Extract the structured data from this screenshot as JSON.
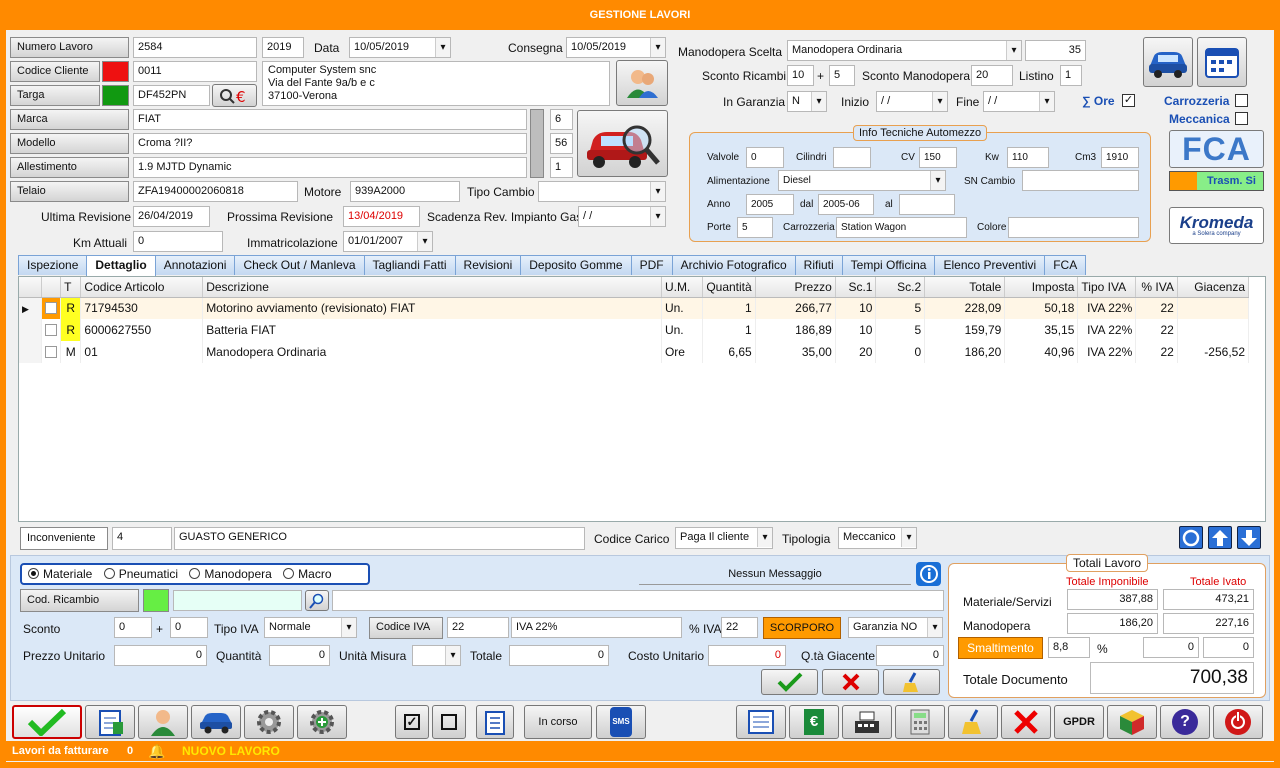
{
  "title": "GESTIONE LAVORI",
  "header": {
    "numero_lavoro_label": "Numero Lavoro",
    "numero_lavoro": "2584",
    "anno": "2019",
    "data_label": "Data",
    "data": "10/05/2019",
    "consegna_label": "Consegna",
    "consegna": "10/05/2019",
    "codice_cliente_label": "Codice Cliente",
    "codice_cliente": "0011",
    "cliente_line1": "Computer System snc",
    "cliente_line2": "Via del Fante 9a/b e c",
    "cliente_line3": "37100-Verona",
    "targa_label": "Targa",
    "targa": "DF452PN",
    "marca_label": "Marca",
    "marca": "FIAT",
    "marca_num": "6",
    "modello_label": "Modello",
    "modello": "Croma ?II?",
    "modello_num": "56",
    "allestimento_label": "Allestimento",
    "allestimento": "1.9 MJTD Dynamic",
    "allestimento_num": "1",
    "telaio_label": "Telaio",
    "telaio": "ZFA19400002060818",
    "motore_label": "Motore",
    "motore": "939A2000",
    "tipo_cambio_label": "Tipo Cambio",
    "tipo_cambio": "",
    "ultima_revisione_label": "Ultima Revisione",
    "ultima_revisione": "26/04/2019",
    "prossima_revisione_label": "Prossima Revisione",
    "prossima_revisione": "13/04/2019",
    "scadenza_gas_label": "Scadenza Rev. Impianto Gas",
    "scadenza_gas": "/ /",
    "km_label": "Km Attuali",
    "km": "0",
    "immatricolazione_label": "Immatricolazione",
    "immatricolazione": "01/01/2007"
  },
  "manodopera": {
    "scelta_label": "Manodopera Scelta",
    "scelta": "Manodopera Ordinaria",
    "scelta_val": "35",
    "sconto_ricambi_label": "Sconto Ricambi",
    "sconto_ricambi_1": "10",
    "plus": "+",
    "sconto_ricambi_2": "5",
    "sconto_manodopera_label": "Sconto Manodopera",
    "sconto_manodopera": "20",
    "listino_label": "Listino",
    "listino": "1",
    "garanzia_label": "In Garanzia",
    "garanzia": "N",
    "inizio_label": "Inizio",
    "inizio": "/ /",
    "fine_label": "Fine",
    "fine": "/ /",
    "sum_ore_label": "∑ Ore",
    "sum_ore_check": "✓",
    "carrozzeria_label": "Carrozzeria",
    "meccanica_label": "Meccanica"
  },
  "info_tecniche": {
    "title": "Info Tecniche Automezzo",
    "valvole_label": "Valvole",
    "valvole": "0",
    "cilindri_label": "Cilindri",
    "cilindri": "",
    "cv_label": "CV",
    "cv": "150",
    "kw_label": "Kw",
    "kw": "110",
    "cm3_label": "Cm3",
    "cm3": "1910",
    "alimentazione_label": "Alimentazione",
    "alimentazione": "Diesel",
    "sn_cambio_label": "SN Cambio",
    "sn_cambio": "",
    "anno_label": "Anno",
    "anno": "2005",
    "dal_label": "dal",
    "dal": "2005-06",
    "al_label": "al",
    "al": "",
    "porte_label": "Porte",
    "porte": "5",
    "carrozzeria_label": "Carrozzeria",
    "carrozzeria": "Station Wagon",
    "colore_label": "Colore",
    "colore": ""
  },
  "brand": {
    "fca": "FCA",
    "trasm": "Trasm. Si",
    "kromeda": "Kromeda",
    "kromeda_sub": "a Solera company"
  },
  "tabs": [
    "Ispezione",
    "Dettaglio",
    "Annotazioni",
    "Check Out / Manleva",
    "Tagliandi Fatti",
    "Revisioni",
    "Deposito Gomme",
    "PDF",
    "Archivio Fotografico",
    "Rifiuti",
    "Tempi Officina",
    "Elenco Preventivi",
    "FCA"
  ],
  "grid": {
    "columns": [
      "",
      "",
      "T",
      "Codice Articolo",
      "Descrizione",
      "U.M.",
      "Quantità",
      "Prezzo",
      "Sc.1",
      "Sc.2",
      "Totale",
      "Imposta",
      "Tipo IVA",
      "% IVA",
      "Giacenza"
    ],
    "rows": [
      {
        "t": "R",
        "codice": "71794530",
        "descrizione": "Motorino avviamento (revisionato) FIAT",
        "um": "Un.",
        "qta": "1",
        "prezzo": "266,77",
        "sc1": "10",
        "sc2": "5",
        "totale": "228,09",
        "imposta": "50,18",
        "tipo_iva": "IVA 22%",
        "perc_iva": "22",
        "giacenza": ""
      },
      {
        "t": "R",
        "codice": "6000627550",
        "descrizione": "Batteria FIAT",
        "um": "Un.",
        "qta": "1",
        "prezzo": "186,89",
        "sc1": "10",
        "sc2": "5",
        "totale": "159,79",
        "imposta": "35,15",
        "tipo_iva": "IVA 22%",
        "perc_iva": "22",
        "giacenza": ""
      },
      {
        "t": "M",
        "codice": "01",
        "descrizione": "Manodopera Ordinaria",
        "um": "Ore",
        "qta": "6,65",
        "prezzo": "35,00",
        "sc1": "20",
        "sc2": "0",
        "totale": "186,20",
        "imposta": "40,96",
        "tipo_iva": "IVA 22%",
        "perc_iva": "22",
        "giacenza": "-256,52"
      }
    ]
  },
  "inconveniente": {
    "label": "Inconveniente",
    "num": "4",
    "desc": "GUASTO GENERICO",
    "codice_carico_label": "Codice Carico",
    "codice_carico": "Paga Il cliente",
    "tipologia_label": "Tipologia",
    "tipologia": "Meccanico"
  },
  "lower": {
    "radio": [
      "Materiale",
      "Pneumatici",
      "Manodopera",
      "Macro"
    ],
    "messaggio": "Nessun Messaggio",
    "cod_ricambio_label": "Cod. Ricambio",
    "sconto_label": "Sconto",
    "sconto1": "0",
    "sconto2": "0",
    "tipo_iva_label": "Tipo IVA",
    "tipo_iva": "Normale",
    "codice_iva_label": "Codice IVA",
    "codice_iva": "22",
    "iva_desc": "IVA 22%",
    "perc_iva_label": "% IVA",
    "perc_iva": "22",
    "scorporo": "SCORPORO",
    "garanzia": "Garanzia NO",
    "prezzo_unitario_label": "Prezzo Unitario",
    "prezzo_unitario": "0",
    "quantita_label": "Quantità",
    "quantita": "0",
    "unita_misura_label": "Unità Misura",
    "totale_label": "Totale",
    "totale": "0",
    "costo_unitario_label": "Costo Unitario",
    "costo_unitario": "0",
    "qta_giacente_label": "Q.tà Giacente",
    "qta_giacente": "0"
  },
  "totali": {
    "title": "Totali Lavoro",
    "imponibile_label": "Totale Imponibile",
    "ivato_label": "Totale Ivato",
    "materiale_label": "Materiale/Servizi",
    "materiale_imp": "387,88",
    "materiale_iva": "473,21",
    "manodopera_label": "Manodopera",
    "manodopera_imp": "186,20",
    "manodopera_iva": "227,16",
    "smaltimento_label": "Smaltimento",
    "smaltimento_perc": "8,8",
    "perc": "%",
    "smaltimento_imp": "0",
    "smaltimento_iva": "0",
    "documento_label": "Totale Documento",
    "documento": "700,38"
  },
  "toolbar": {
    "in_corso": "In corso",
    "gpdr": "GPDR",
    "sms": "SMS"
  },
  "status": {
    "lavori_label": "Lavori da fatturare",
    "lavori_count": "0",
    "nuovo": "NUOVO LAVORO"
  },
  "colors": {
    "orange": "#ff8a00",
    "accent_blue": "#1a4fb4",
    "red": "#d00000",
    "green": "#33cc33"
  }
}
